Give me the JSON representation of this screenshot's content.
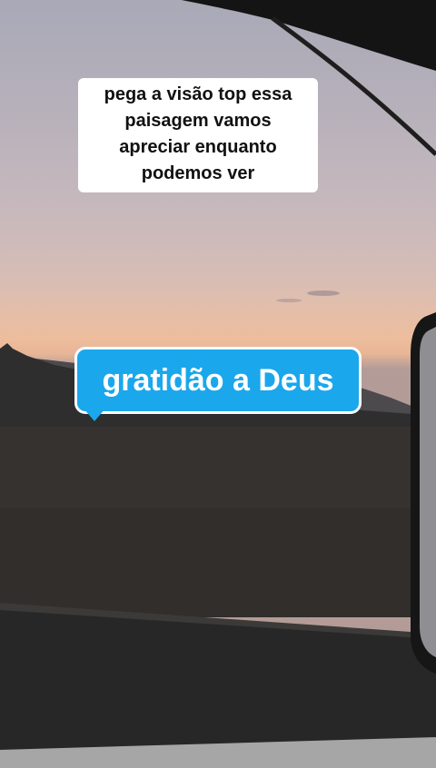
{
  "video": {
    "scene": "sunset-landscape-through-truck-window",
    "colors": {
      "sky_top": "#a9a9b7",
      "sky_glow": "#edbd9d",
      "field": "#2c2a28",
      "bubble": "#1aa7ec"
    }
  },
  "caption": {
    "lines": [
      "pega a visão top essa",
      "paisagem vamos",
      "apreciar enquanto",
      "podemos ver"
    ]
  },
  "sticker": {
    "text": "gratidão a Deus"
  }
}
